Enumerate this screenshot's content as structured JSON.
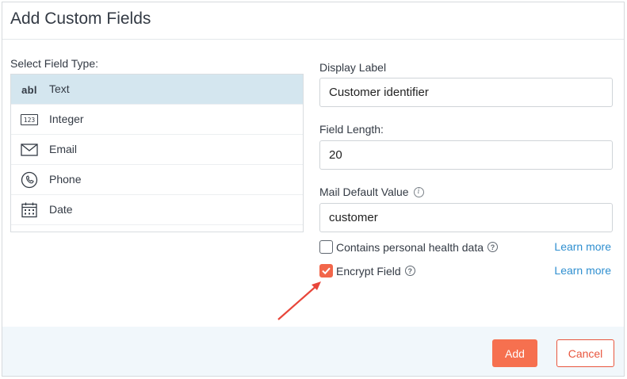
{
  "dialog": {
    "title": "Add Custom Fields"
  },
  "field_types": {
    "label": "Select Field Type:",
    "items": [
      {
        "label": "Text",
        "icon": "abl",
        "icon_name": "text-abl-icon",
        "selected": true
      },
      {
        "label": "Integer",
        "icon": "123",
        "icon_name": "integer-123-icon",
        "selected": false
      },
      {
        "label": "Email",
        "icon_name": "envelope-icon",
        "selected": false
      },
      {
        "label": "Phone",
        "icon_name": "phone-icon",
        "selected": false
      },
      {
        "label": "Date",
        "icon_name": "calendar-icon",
        "selected": false
      }
    ]
  },
  "form": {
    "display_label": {
      "label": "Display Label",
      "value": "Customer identifier"
    },
    "field_length": {
      "label": "Field Length:",
      "value": "20"
    },
    "default_value": {
      "label": "Mail Default Value",
      "value": "customer"
    },
    "personal_health": {
      "label": "Contains personal health data",
      "checked": false,
      "learn_more": "Learn more"
    },
    "encrypt": {
      "label": "Encrypt Field",
      "checked": true,
      "learn_more": "Learn more"
    }
  },
  "footer": {
    "add_label": "Add",
    "cancel_label": "Cancel"
  },
  "colors": {
    "accent": "#f6704f",
    "selected_row": "#d4e6ef",
    "link": "#2f8fd0",
    "footer_bg": "#f1f7fb",
    "annotation_arrow": "#e8463a"
  }
}
